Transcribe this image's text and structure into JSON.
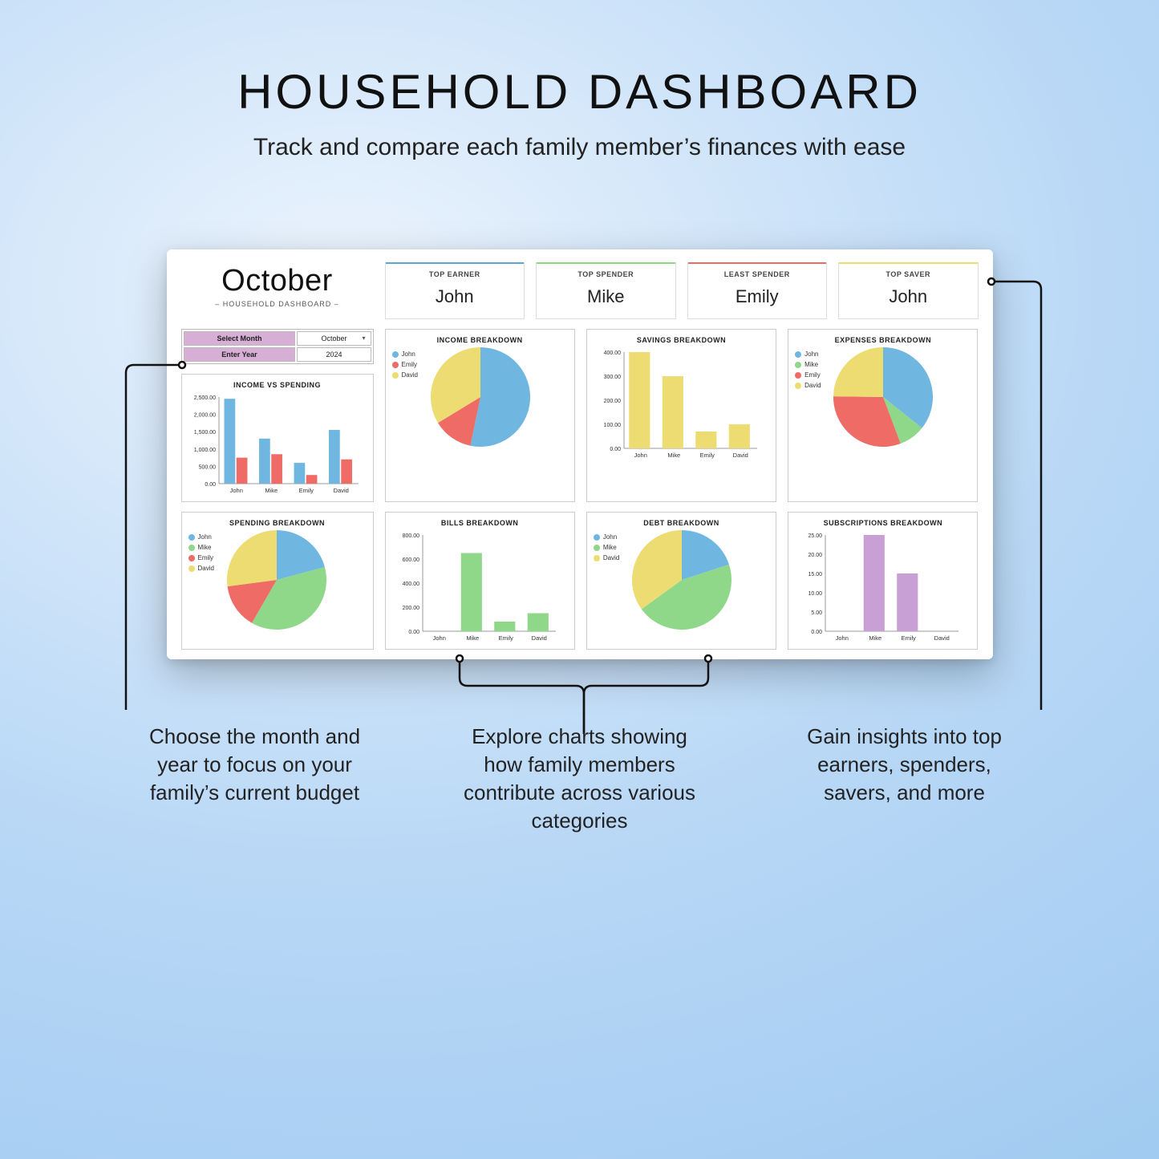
{
  "header": {
    "title": "HOUSEHOLD DASHBOARD",
    "subtitle": "Track and compare each family member’s finances with ease"
  },
  "dashboard": {
    "month": "October",
    "subtitle": "– HOUSEHOLD DASHBOARD –",
    "selectors": {
      "month_label": "Select Month",
      "month_value": "October",
      "year_label": "Enter Year",
      "year_value": "2024"
    },
    "stats": [
      {
        "label": "TOP EARNER",
        "value": "John",
        "accent": "blue"
      },
      {
        "label": "TOP SPENDER",
        "value": "Mike",
        "accent": "green"
      },
      {
        "label": "LEAST SPENDER",
        "value": "Emily",
        "accent": "red"
      },
      {
        "label": "TOP SAVER",
        "value": "John",
        "accent": "yellow"
      }
    ]
  },
  "people": [
    "John",
    "Mike",
    "Emily",
    "David"
  ],
  "colors": {
    "John": "#6fb6e0",
    "Mike": "#8fd88a",
    "Emily": "#ef6b66",
    "David": "#ecdc71",
    "purple": "#c9a0d6"
  },
  "chart_data": [
    {
      "id": "income_vs_spending",
      "title": "INCOME VS SPENDING",
      "type": "bar",
      "categories": [
        "John",
        "Mike",
        "Emily",
        "David"
      ],
      "series": [
        {
          "name": "Income",
          "color": "#6fb6e0",
          "values": [
            2450,
            1300,
            600,
            1550
          ]
        },
        {
          "name": "Spending",
          "color": "#ef6b66",
          "values": [
            750,
            850,
            250,
            700
          ]
        }
      ],
      "yticks": [
        0,
        500,
        1000,
        1500,
        2000,
        2500
      ],
      "ylim": [
        0,
        2500
      ],
      "ytick_fmt": "0.00"
    },
    {
      "id": "income_breakdown",
      "title": "INCOME BREAKDOWN",
      "type": "pie",
      "series": [
        {
          "name": "John",
          "value": 2450,
          "color": "#6fb6e0"
        },
        {
          "name": "Emily",
          "value": 600,
          "color": "#ef6b66"
        },
        {
          "name": "David",
          "value": 1550,
          "color": "#ecdc71"
        }
      ]
    },
    {
      "id": "savings_breakdown",
      "title": "SAVINGS BREAKDOWN",
      "type": "bar",
      "categories": [
        "John",
        "Mike",
        "Emily",
        "David"
      ],
      "series": [
        {
          "name": "Savings",
          "color": "#ecdc71",
          "values": [
            400,
            300,
            70,
            100
          ]
        }
      ],
      "yticks": [
        0,
        100,
        200,
        300,
        400
      ],
      "ylim": [
        0,
        400
      ],
      "ytick_fmt": "0.00"
    },
    {
      "id": "expenses_breakdown",
      "title": "EXPENSES BREAKDOWN",
      "type": "pie",
      "series": [
        {
          "name": "John",
          "value": 750,
          "color": "#6fb6e0"
        },
        {
          "name": "Mike",
          "value": 180,
          "color": "#8fd88a"
        },
        {
          "name": "Emily",
          "value": 650,
          "color": "#ef6b66"
        },
        {
          "name": "David",
          "value": 520,
          "color": "#ecdc71"
        }
      ]
    },
    {
      "id": "spending_breakdown",
      "title": "SPENDING BREAKDOWN",
      "type": "pie",
      "series": [
        {
          "name": "John",
          "value": 500,
          "color": "#6fb6e0"
        },
        {
          "name": "Mike",
          "value": 900,
          "color": "#8fd88a"
        },
        {
          "name": "Emily",
          "value": 350,
          "color": "#ef6b66"
        },
        {
          "name": "David",
          "value": 650,
          "color": "#ecdc71"
        }
      ]
    },
    {
      "id": "bills_breakdown",
      "title": "BILLS BREAKDOWN",
      "type": "bar",
      "categories": [
        "John",
        "Mike",
        "Emily",
        "David"
      ],
      "series": [
        {
          "name": "Bills",
          "color": "#8fd88a",
          "values": [
            0,
            650,
            80,
            150
          ]
        }
      ],
      "yticks": [
        0,
        200,
        400,
        600,
        800
      ],
      "ylim": [
        0,
        800
      ],
      "ytick_fmt": "0.00"
    },
    {
      "id": "debt_breakdown",
      "title": "DEBT BREAKDOWN",
      "type": "pie",
      "series": [
        {
          "name": "John",
          "value": 400,
          "color": "#6fb6e0"
        },
        {
          "name": "Mike",
          "value": 900,
          "color": "#8fd88a"
        },
        {
          "name": "David",
          "value": 700,
          "color": "#ecdc71"
        }
      ]
    },
    {
      "id": "subscriptions_breakdown",
      "title": "SUBSCRIPTIONS BREAKDOWN",
      "type": "bar",
      "categories": [
        "John",
        "Mike",
        "Emily",
        "David"
      ],
      "series": [
        {
          "name": "Subs",
          "color": "#c9a0d6",
          "values": [
            0,
            25,
            15,
            0
          ]
        }
      ],
      "yticks": [
        0,
        5,
        10,
        15,
        20,
        25
      ],
      "ylim": [
        0,
        25
      ],
      "ytick_fmt": "0.00"
    }
  ],
  "callouts": {
    "left": "Choose the month and year to focus on your family’s current budget",
    "center": "Explore charts showing how family members contribute across various categories",
    "right": "Gain insights into top earners, spenders, savers, and more"
  }
}
